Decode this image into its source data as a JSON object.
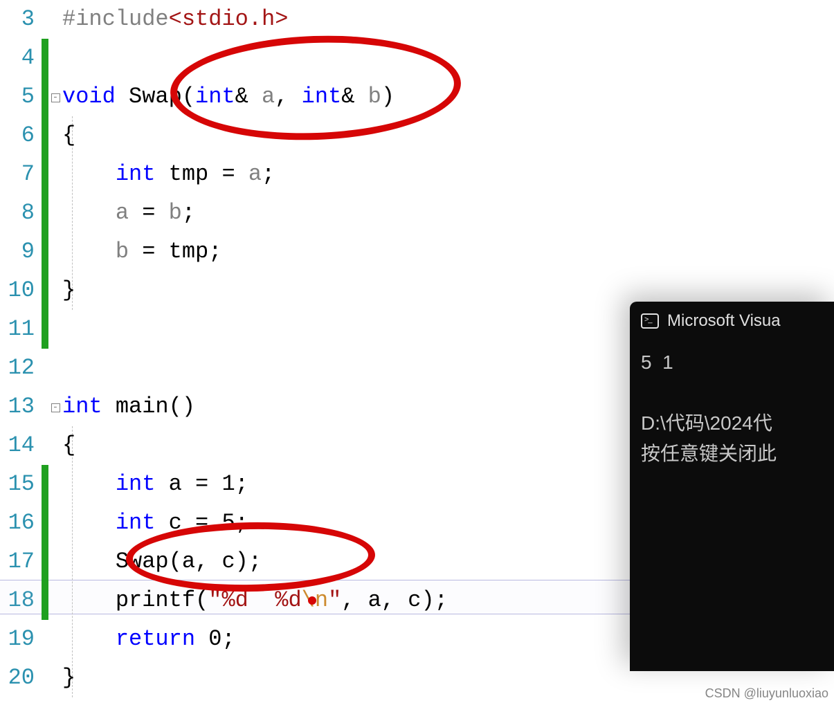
{
  "lines": {
    "num_3": "3",
    "num_4": "4",
    "num_5": "5",
    "num_6": "6",
    "num_7": "7",
    "num_8": "8",
    "num_9": "9",
    "num_10": "10",
    "num_11": "11",
    "num_12": "12",
    "num_13": "13",
    "num_14": "14",
    "num_15": "15",
    "num_16": "16",
    "num_17": "17",
    "num_18": "18",
    "num_19": "19",
    "num_20": "20"
  },
  "code": {
    "l3_pp": "#include",
    "l3_hdr": "<stdio.h>",
    "l5_kw": "void",
    "l5_sp1": " ",
    "l5_fn": "Swap",
    "l5_op": "(",
    "l5_t1": "int",
    "l5_amp1": "& ",
    "l5_p1": "a",
    "l5_comma": ", ",
    "l5_t2": "int",
    "l5_amp2": "& ",
    "l5_p2": "b",
    "l5_cp": ")",
    "l6_ob": "{",
    "l7_indent": "    ",
    "l7_kw": "int",
    "l7_sp": " ",
    "l7_tmp": "tmp",
    "l7_eq": " = ",
    "l7_a": "a",
    "l7_sc": ";",
    "l8_indent": "    ",
    "l8_a": "a",
    "l8_eq": " = ",
    "l8_b": "b",
    "l8_sc": ";",
    "l9_indent": "    ",
    "l9_b": "b",
    "l9_eq": " = ",
    "l9_tmp": "tmp",
    "l9_sc": ";",
    "l10_cb": "}",
    "l13_kw": "int",
    "l13_sp": " ",
    "l13_fn": "main",
    "l13_par": "()",
    "l14_ob": "{",
    "l15_indent": "    ",
    "l15_kw": "int",
    "l15_sp": " ",
    "l15_a": "a",
    "l15_eq": " = ",
    "l15_v": "1",
    "l15_sc": ";",
    "l16_indent": "    ",
    "l16_kw": "int",
    "l16_sp": " ",
    "l16_c": "c",
    "l16_eq": " = ",
    "l16_v": "5",
    "l16_sc": ";",
    "l17_indent": "    ",
    "l17_fn": "Swap",
    "l17_op": "(",
    "l17_a": "a",
    "l17_comma": ", ",
    "l17_c": "c",
    "l17_cp": ")",
    "l17_sc": ";",
    "l18_indent": "    ",
    "l18_fn": "printf",
    "l18_op": "(",
    "l18_str1": "\"%d  %d",
    "l18_esc": "\\n",
    "l18_str2": "\"",
    "l18_comma1": ", ",
    "l18_a": "a",
    "l18_comma2": ", ",
    "l18_c": "c",
    "l18_cp": ")",
    "l18_sc": ";",
    "l19_indent": "    ",
    "l19_kw": "return",
    "l19_sp": " ",
    "l19_v": "0",
    "l19_sc": ";",
    "l20_cb": "}"
  },
  "console": {
    "title": "Microsoft Visua",
    "output_line1": "5  1",
    "output_line2": "",
    "output_line3": "D:\\代码\\2024代",
    "output_line4": "按任意键关闭此"
  },
  "watermark": "CSDN @liuyunluoxiao"
}
